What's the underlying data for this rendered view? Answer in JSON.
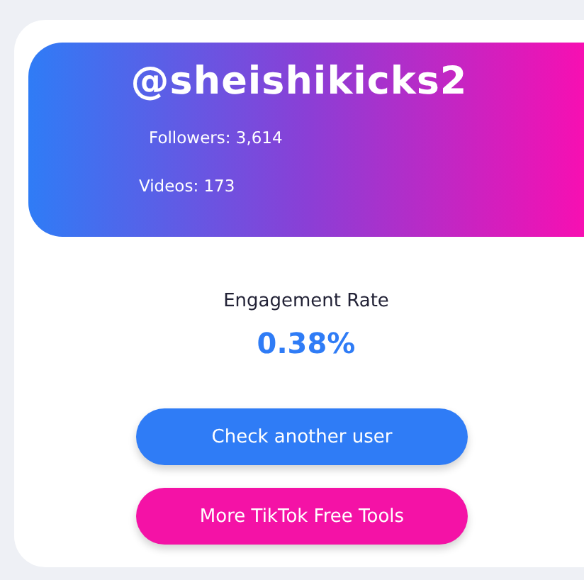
{
  "profile": {
    "username": "@sheishikicks2",
    "followers": "Followers: 3,614",
    "videos": "Videos: 173"
  },
  "engagement": {
    "label": "Engagement Rate",
    "value": "0.38%"
  },
  "buttons": [
    {
      "label": "Check another user",
      "kind": "primary"
    },
    {
      "label": "More TikTok Free Tools",
      "kind": "secondary"
    }
  ]
}
